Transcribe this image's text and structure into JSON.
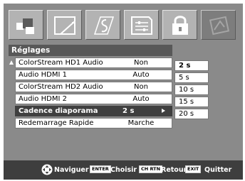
{
  "menu": {
    "title": "Réglages",
    "items": [
      {
        "label": "ColorStream HD1 Audio",
        "value": "Non"
      },
      {
        "label": "Audio HDMI 1",
        "value": "Auto"
      },
      {
        "label": "ColorStream HD2 Audio",
        "value": "Non"
      },
      {
        "label": "Audio HDMI 2",
        "value": "Auto"
      },
      {
        "label": "Cadence diaporama",
        "value": "2 s",
        "selected": true
      },
      {
        "label": "Redemarrage Rapide",
        "value": "Marche"
      }
    ]
  },
  "dropdown": {
    "options": [
      "2 s",
      "5 s",
      "10 s",
      "15 s",
      "20 s"
    ],
    "selected": "2 s"
  },
  "tabs": [
    "picture-icon",
    "display-icon",
    "audio-icon",
    "settings-icon",
    "lock-icon",
    "setup-icon"
  ],
  "footer": {
    "navigate": "Naviguer",
    "enter_key": "ENTER",
    "choose": "Choisir",
    "return_key": "CH RTN",
    "back": "Retour",
    "exit_key": "EXIT",
    "quit": "Quitter"
  }
}
